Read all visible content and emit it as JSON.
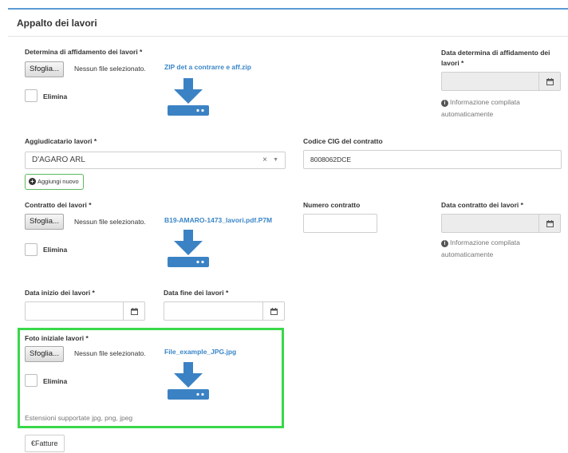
{
  "panel": {
    "title": "Appalto dei lavori"
  },
  "labels": {
    "determina": "Determina di affidamento dei lavori *",
    "data_determina": "Data determina di affidamento dei lavori *",
    "aggiudicatario": "Aggiudicatario lavori *",
    "cig": "Codice CIG del contratto",
    "contratto": "Contratto dei lavori *",
    "numero_contratto": "Numero contratto",
    "data_contratto": "Data contratto dei lavori *",
    "data_inizio": "Data inizio dei lavori *",
    "data_fine": "Data fine dei lavori *",
    "foto": "Foto iniziale lavori *"
  },
  "file_input": {
    "browse": "Sfoglia...",
    "no_file": "Nessun file selezionato."
  },
  "files": {
    "determina": "ZIP det a contrarre e aff.zip",
    "contratto": "B19-AMARO-1473_lavori.pdf.P7M",
    "foto": "File_example_JPG.jpg"
  },
  "elimina": "Elimina",
  "info": {
    "auto": "Informazione compilata automaticamente"
  },
  "aggiudicatario": {
    "selected": "D'AGARO ARL",
    "add_new": "Aggiungi nuovo"
  },
  "cig": {
    "value": "8008062DCE"
  },
  "foto": {
    "hint": "Estensioni supportate jpg, png, jpeg"
  },
  "buttons": {
    "fatture": "€Fatture"
  },
  "icons": {
    "download": "download-tray-icon",
    "calendar": "calendar-icon",
    "info": "info-circle-icon",
    "plus": "plus-circle-icon"
  },
  "colors": {
    "accent_link": "#3a86c8",
    "download_icon": "#3b82c4",
    "highlight": "#39d84a",
    "add_button_border": "#5cb85c"
  }
}
